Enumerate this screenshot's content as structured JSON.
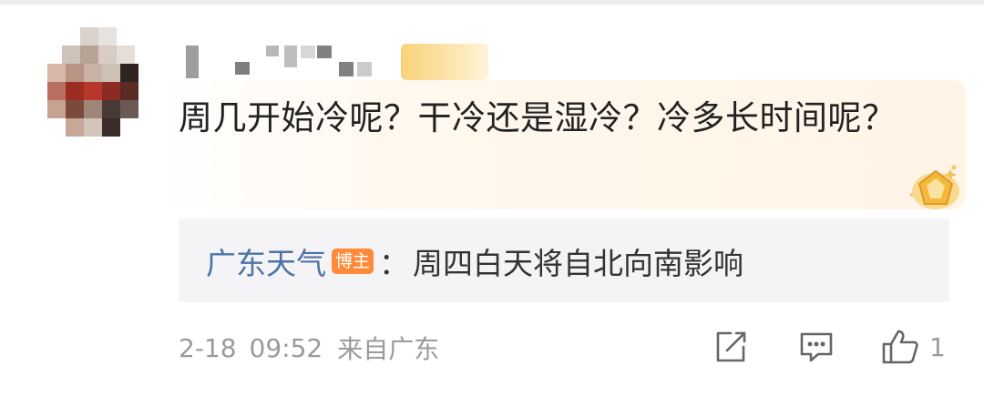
{
  "comment": {
    "text": "周几开始冷呢？干冷还是湿冷？冷多长时间呢？"
  },
  "reply": {
    "author": "广东天气",
    "badge": "博主",
    "colon": "：",
    "text": "周四白天将自北向南影响"
  },
  "footer": {
    "date": "2-18",
    "time": "09:52",
    "source": "来自广东",
    "like_count": "1"
  },
  "icons": {
    "share": "share-edit-icon",
    "comment": "comment-icon",
    "like": "thumb-up-icon",
    "medal": "medal-badge-icon"
  },
  "colors": {
    "author_link": "#4d73a6",
    "blogger_badge": "#ff8a3a",
    "meta_text": "#9a9a9a",
    "reply_bg": "#f4f4f6"
  }
}
